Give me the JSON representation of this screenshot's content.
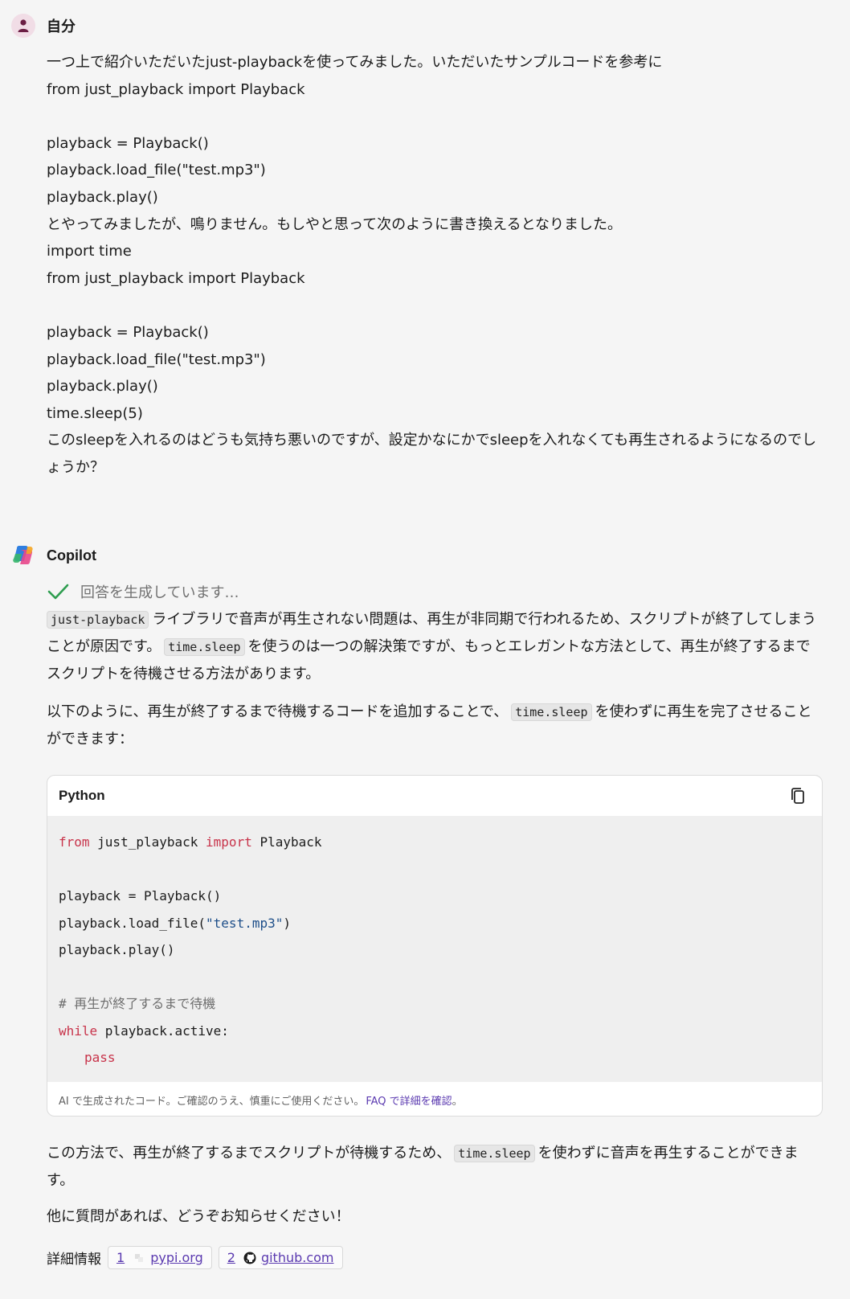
{
  "user": {
    "name": "自分",
    "lines": [
      "一つ上で紹介いただいたjust-playbackを使ってみました。いただいたサンプルコードを参考に",
      "from just_playback import Playback",
      "",
      "playback = Playback()",
      "playback.load_file(\"test.mp3\")",
      "playback.play()",
      "とやってみましたが、鳴りません。もしやと思って次のように書き換えるとなりました。",
      "import time",
      "from just_playback import Playback",
      "",
      "playback = Playback()",
      "playback.load_file(\"test.mp3\")",
      "playback.play()",
      "time.sleep(5)",
      "このsleepを入れるのはどうも気持ち悪いのですが、設定かなにかでsleepを入れなくても再生されるようになるのでしょうか？"
    ]
  },
  "copilot": {
    "name": "Copilot",
    "status": "回答を生成しています…",
    "p1": {
      "code1": "just-playback",
      "text1": "ライブラリで音声が再生されない問題は、再生が非同期で行われるため、スクリプトが終了してしまうことが原因です。",
      "code2": "time.sleep",
      "text2": "を使うのは一つの解決策ですが、もっとエレガントな方法として、再生が終了するまでスクリプトを待機させる方法があります。"
    },
    "p2": {
      "text1": "以下のように、再生が終了するまで待機するコードを追加することで、",
      "code1": "time.sleep",
      "text2": "を使わずに再生を完了させることができます："
    },
    "code_block": {
      "language": "Python",
      "lines": {
        "l1_kw1": "from",
        "l1_mid": " just_playback ",
        "l1_kw2": "import",
        "l1_end": " Playback",
        "l3": "playback = Playback()",
        "l4_pre": "playback.load_file(",
        "l4_str": "\"test.mp3\"",
        "l4_post": ")",
        "l5": "playback.play()",
        "l7_comment": "# 再生が終了するまで待機",
        "l8_kw": "while",
        "l8_rest": " playback.active:",
        "l9_kw": "pass"
      },
      "disclaimer": "AI で生成されたコード。ご確認のうえ、慎重にご使用ください。",
      "faq_link": "FAQ で詳細を確認",
      "faq_suffix": "。"
    },
    "p3": {
      "text1": "この方法で、再生が終了するまでスクリプトが待機するため、",
      "code1": "time.sleep",
      "text2": "を使わずに音声を再生することができます。"
    },
    "p4": "他に質問があれば、どうぞお知らせください！",
    "refs": {
      "label": "詳細情報",
      "items": [
        {
          "num": "1",
          "site": "pypi.org",
          "icon": "pypi-icon"
        },
        {
          "num": "2",
          "site": "github.com",
          "icon": "github-icon"
        }
      ]
    }
  },
  "colors": {
    "background": "#f5f5f5",
    "keyword": "#c8334a",
    "string": "#1d4e89",
    "link": "#5b3ab0",
    "check": "#2e9d4f"
  }
}
